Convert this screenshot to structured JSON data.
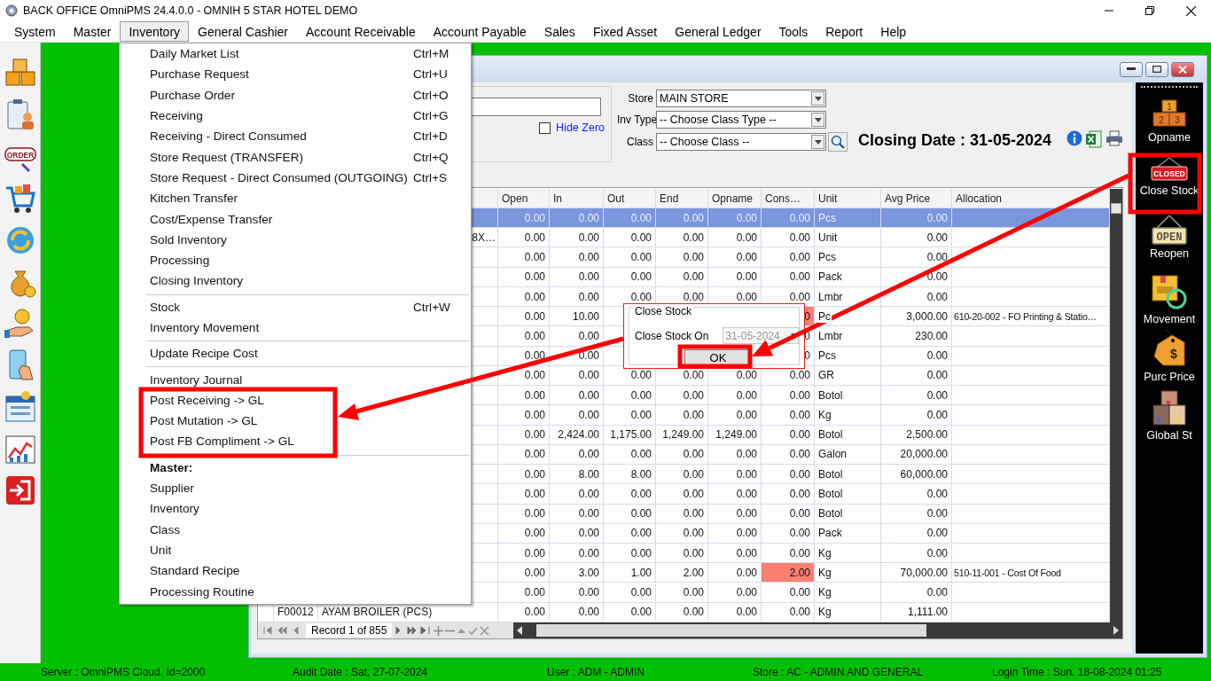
{
  "window": {
    "title": "BACK OFFICE OmniPMS 24.4.0.0 - OMNIH 5 STAR HOTEL DEMO"
  },
  "menu_bar": [
    {
      "label": "System",
      "selected": false
    },
    {
      "label": "Master",
      "selected": false
    },
    {
      "label": "Inventory",
      "selected": true
    },
    {
      "label": "General Cashier",
      "selected": false
    },
    {
      "label": "Account Receivable",
      "selected": false
    },
    {
      "label": "Account Payable",
      "selected": false
    },
    {
      "label": "Sales",
      "selected": false
    },
    {
      "label": "Fixed Asset",
      "selected": false
    },
    {
      "label": "General Ledger",
      "selected": false
    },
    {
      "label": "Tools",
      "selected": false
    },
    {
      "label": "Report",
      "selected": false
    },
    {
      "label": "Help",
      "selected": false
    }
  ],
  "left_toolbar": {
    "order_sign": "ORDER"
  },
  "inventory_menu": [
    {
      "items": [
        {
          "kind": "item",
          "label": "Daily Market List",
          "shortcut": "Ctrl+M"
        },
        {
          "kind": "item",
          "label": "Purchase Request",
          "shortcut": "Ctrl+U"
        },
        {
          "kind": "item",
          "label": "Purchase Order",
          "shortcut": "Ctrl+O"
        },
        {
          "kind": "item",
          "label": "Receiving",
          "shortcut": "Ctrl+G"
        },
        {
          "kind": "item",
          "label": "Receiving - Direct Consumed",
          "shortcut": "Ctrl+D"
        },
        {
          "kind": "item",
          "label": "Store Request (TRANSFER)",
          "shortcut": "Ctrl+Q"
        },
        {
          "kind": "item",
          "label": "Store Request - Direct Consumed (OUTGOING)",
          "shortcut": "Ctrl+S"
        },
        {
          "kind": "item",
          "label": "Kitchen Transfer"
        },
        {
          "kind": "item",
          "label": "Cost/Expense Transfer"
        },
        {
          "kind": "item",
          "label": "Sold Inventory"
        },
        {
          "kind": "item",
          "label": "Processing"
        },
        {
          "kind": "item",
          "label": "Closing Inventory"
        }
      ]
    },
    {
      "items": [
        {
          "kind": "item",
          "label": "Stock",
          "shortcut": "Ctrl+W"
        },
        {
          "kind": "item",
          "label": "Inventory Movement"
        }
      ]
    },
    {
      "items": [
        {
          "kind": "item",
          "label": "Update Recipe Cost"
        }
      ]
    },
    {
      "items": [
        {
          "kind": "item",
          "label": "Inventory Journal"
        },
        {
          "kind": "item",
          "label": "Post Receiving -> GL"
        },
        {
          "kind": "item",
          "label": "Post Mutation -> GL"
        },
        {
          "kind": "item",
          "label": "Post FB Compliment -> GL"
        }
      ]
    },
    {
      "items": [
        {
          "kind": "heading",
          "label": "Master:"
        },
        {
          "kind": "item",
          "label": "Supplier"
        },
        {
          "kind": "item",
          "label": "Inventory"
        },
        {
          "kind": "item",
          "label": "Class"
        },
        {
          "kind": "item",
          "label": "Unit"
        },
        {
          "kind": "item",
          "label": "Standard Recipe"
        },
        {
          "kind": "item",
          "label": "Processing Routine"
        }
      ]
    }
  ],
  "filters": {
    "hide_zero": {
      "label": "Hide Zero",
      "checked": false
    },
    "fields": [
      {
        "label": "Store",
        "value": "MAIN STORE"
      },
      {
        "label": "Inv Type",
        "value": "-- Choose Class Type --"
      },
      {
        "label": "Class",
        "value": "-- Choose Class --"
      }
    ],
    "closing_date": "Closing Date : 31-05-2024"
  },
  "table": {
    "columns": [
      "Open",
      "In",
      "Out",
      "End",
      "Opname",
      "Cons…",
      "Unit",
      "Avg Price",
      "Allocation"
    ],
    "rows": [
      {
        "selected": true,
        "cons_alert": false,
        "cells": [
          "0.00",
          "0.00",
          "0.00",
          "0.00",
          "0.00",
          "0.00",
          "Pcs",
          "0.00",
          null
        ]
      },
      {
        "selected": false,
        "cons_alert": false,
        "name_tail": "8X…",
        "cells": [
          "0.00",
          "0.00",
          "0.00",
          "0.00",
          "0.00",
          "0.00",
          "Unit",
          "0.00",
          null
        ]
      },
      {
        "selected": false,
        "cons_alert": false,
        "cells": [
          "0.00",
          "0.00",
          "0.00",
          "0.00",
          "0.00",
          "0.00",
          "Pcs",
          "0.00",
          null
        ]
      },
      {
        "selected": false,
        "cons_alert": false,
        "cells": [
          "0.00",
          "0.00",
          "0.00",
          "0.00",
          "0.00",
          "0.00",
          "Pack",
          "0.00",
          null
        ]
      },
      {
        "selected": false,
        "cons_alert": false,
        "cells": [
          "0.00",
          "0.00",
          "0.00",
          "0.00",
          "0.00",
          "0.00",
          "Lmbr",
          "0.00",
          null
        ]
      },
      {
        "selected": false,
        "cons_alert": true,
        "cells": [
          "0.00",
          "10.00",
          null,
          null,
          null,
          "0",
          "Pc",
          "3,000.00",
          "610-20-002 - FO Printing & Statio…"
        ]
      },
      {
        "selected": false,
        "cons_alert": false,
        "cells": [
          "0.00",
          "0.00",
          null,
          null,
          null,
          "0",
          "Lmbr",
          "230.00",
          null
        ]
      },
      {
        "selected": false,
        "cons_alert": false,
        "cells": [
          "0.00",
          "0.00",
          null,
          null,
          null,
          "0",
          "Pcs",
          "0.00",
          null
        ]
      },
      {
        "selected": false,
        "cons_alert": false,
        "cells": [
          "0.00",
          "0.00",
          "0.00",
          "0.00",
          "0.00",
          "0.00",
          "GR",
          "0.00",
          null
        ]
      },
      {
        "selected": false,
        "cons_alert": false,
        "cells": [
          "0.00",
          "0.00",
          "0.00",
          "0.00",
          "0.00",
          "0.00",
          "Botol",
          "0.00",
          null
        ]
      },
      {
        "selected": false,
        "cons_alert": false,
        "cells": [
          "0.00",
          "0.00",
          "0.00",
          "0.00",
          "0.00",
          "0.00",
          "Kg",
          "0.00",
          null
        ]
      },
      {
        "selected": false,
        "cons_alert": false,
        "cells": [
          "0.00",
          "2,424.00",
          "1,175.00",
          "1,249.00",
          "1,249.00",
          "0.00",
          "Botol",
          "2,500.00",
          null
        ]
      },
      {
        "selected": false,
        "cons_alert": false,
        "cells": [
          "0.00",
          "0.00",
          "0.00",
          "0.00",
          "0.00",
          "0.00",
          "Galon",
          "20,000.00",
          null
        ]
      },
      {
        "selected": false,
        "cons_alert": false,
        "cells": [
          "0.00",
          "8.00",
          "8.00",
          "0.00",
          "0.00",
          "0.00",
          "Botol",
          "60,000.00",
          null
        ]
      },
      {
        "selected": false,
        "cons_alert": false,
        "cells": [
          "0.00",
          "0.00",
          "0.00",
          "0.00",
          "0.00",
          "0.00",
          "Botol",
          "0.00",
          null
        ]
      },
      {
        "selected": false,
        "cons_alert": false,
        "cells": [
          "0.00",
          "0.00",
          "0.00",
          "0.00",
          "0.00",
          "0.00",
          "Botol",
          "0.00",
          null
        ]
      },
      {
        "selected": false,
        "cons_alert": false,
        "cells": [
          "0.00",
          "0.00",
          "0.00",
          "0.00",
          "0.00",
          "0.00",
          "Pack",
          "0.00",
          null
        ]
      },
      {
        "selected": false,
        "cons_alert": false,
        "cells": [
          "0.00",
          "0.00",
          "0.00",
          "0.00",
          "0.00",
          "0.00",
          "Kg",
          "0.00",
          null
        ]
      },
      {
        "selected": false,
        "cons_alert": true,
        "cells": [
          "0.00",
          "3.00",
          "1.00",
          "2.00",
          "0.00",
          "2.00",
          "Kg",
          "70,000.00",
          "510-11-001 - Cost Of Food"
        ]
      },
      {
        "selected": false,
        "cons_alert": false,
        "cells": [
          "0.00",
          "0.00",
          "0.00",
          "0.00",
          "0.00",
          "0.00",
          "Kg",
          "0.00",
          null
        ]
      },
      {
        "selected": false,
        "cons_alert": false,
        "code": "F00012",
        "name": "AYAM BROILER (PCS)",
        "cells": [
          "0.00",
          "0.00",
          "0.00",
          "0.00",
          "0.00",
          "0.00",
          "Kg",
          "1,111.00",
          null
        ]
      }
    ],
    "record": "Record 1 of 855"
  },
  "tools": [
    {
      "kind": "opname",
      "label": "Opname",
      "signs": [
        "1",
        "2",
        "3"
      ]
    },
    {
      "kind": "close",
      "label": "Close Stock",
      "signs": [
        "CLOSED"
      ]
    },
    {
      "kind": "reopen",
      "label": "Reopen",
      "signs": [
        "OPEN"
      ]
    },
    {
      "kind": "movement",
      "label": "Movement"
    },
    {
      "kind": "price",
      "label": "Purc Price",
      "signs": [
        "$"
      ]
    },
    {
      "kind": "global",
      "label": "Global St"
    }
  ],
  "dialog": {
    "title": "Close Stock",
    "label": "Close Stock On",
    "date": "31-05-2024",
    "date_disabled": true,
    "button": "OK"
  },
  "status_bar": [
    "Server : OmniPMS Cloud, Id=2000",
    "Audit Date : Sat, 27-07-2024",
    "User : ADM - ADMIN",
    "Store : AC - ADMIN AND GENERAL",
    "Login Time : Sun, 18-08-2024 01:25"
  ]
}
